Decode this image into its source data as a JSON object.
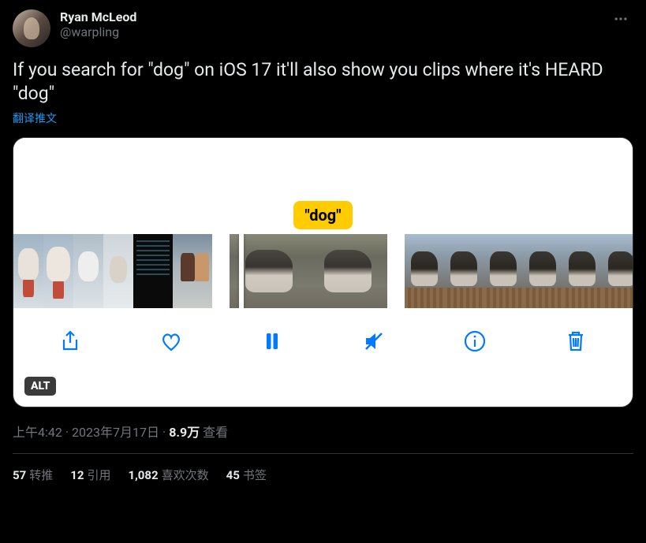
{
  "user": {
    "display_name": "Ryan McLeod",
    "handle": "@warpling"
  },
  "tweet_text": "If you search for \"dog\" on iOS 17 it'll also show you clips where it's HEARD \"dog\"",
  "translate_label": "翻译推文",
  "media": {
    "search_tag": "\"dog\"",
    "alt_badge": "ALT",
    "toolbar": {
      "share": "share",
      "like": "like",
      "pause": "pause",
      "mute": "mute",
      "info": "info",
      "delete": "delete"
    }
  },
  "meta": {
    "time": "上午4:42",
    "date": "2023年7月17日",
    "views_num": "8.9万",
    "views_label": "查看"
  },
  "stats": {
    "retweets_num": "57",
    "retweets_label": "转推",
    "quotes_num": "12",
    "quotes_label": "引用",
    "likes_num": "1,082",
    "likes_label": "喜欢次数",
    "bookmarks_num": "45",
    "bookmarks_label": "书签"
  }
}
